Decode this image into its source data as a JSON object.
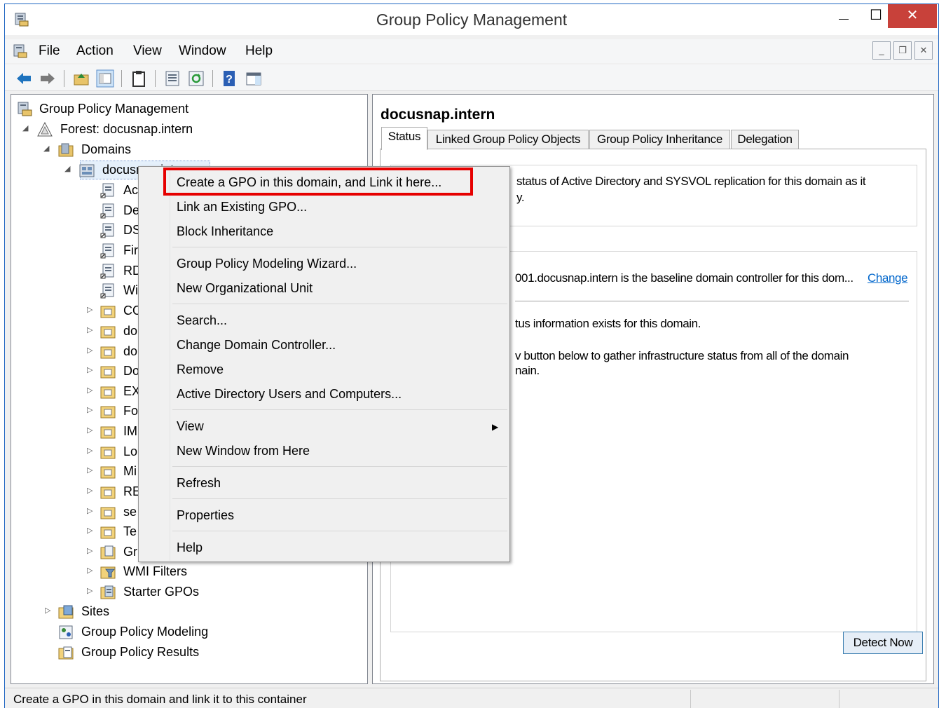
{
  "window": {
    "title": "Group Policy Management",
    "close_glyph": "✕",
    "min_glyph": "—",
    "max_glyph": "☐"
  },
  "menubar": {
    "items": [
      "File",
      "Action",
      "View",
      "Window",
      "Help"
    ]
  },
  "tree": {
    "root": "Group Policy Management",
    "forest": "Forest: docusnap.intern",
    "domains": "Domains",
    "domain": "docusnap.intern",
    "children": [
      {
        "label": "Ac",
        "type": "gpo-link"
      },
      {
        "label": "De",
        "type": "gpo-link"
      },
      {
        "label": "DS",
        "type": "gpo-link"
      },
      {
        "label": "Fir",
        "type": "gpo-link"
      },
      {
        "label": "RD",
        "type": "gpo-link"
      },
      {
        "label": "Wi",
        "type": "gpo-link"
      },
      {
        "label": "CO",
        "type": "ou"
      },
      {
        "label": "do",
        "type": "ou"
      },
      {
        "label": "do",
        "type": "ou"
      },
      {
        "label": "Do",
        "type": "ou"
      },
      {
        "label": "EX",
        "type": "ou"
      },
      {
        "label": "Fo",
        "type": "ou"
      },
      {
        "label": "IM",
        "type": "ou"
      },
      {
        "label": "Lo",
        "type": "ou"
      },
      {
        "label": "Mi",
        "type": "ou"
      },
      {
        "label": "RE",
        "type": "ou"
      },
      {
        "label": "se",
        "type": "ou"
      },
      {
        "label": "Te",
        "type": "ou"
      },
      {
        "label": "Gr",
        "type": "gpo-folder"
      },
      {
        "label": "WMI Filters",
        "type": "wmi"
      },
      {
        "label": "Starter GPOs",
        "type": "starter"
      }
    ],
    "sites": "Sites",
    "modeling": "Group Policy Modeling",
    "results": "Group Policy Results"
  },
  "right": {
    "title": "docusnap.intern",
    "tabs": [
      "Status",
      "Linked Group Policy Objects",
      "Group Policy Inheritance",
      "Delegation"
    ],
    "active_tab": "Status",
    "text1a": "status of Active Directory and SYSVOL replication for this domain as it",
    "text1b": "y.",
    "text2": "001.docusnap.intern is the baseline domain controller for this dom...",
    "change_link": "Change",
    "text3": "tus information exists for this domain.",
    "text4a": "v button below to gather infrastructure status from all of the domain",
    "text4b": "nain.",
    "detect_button": "Detect Now"
  },
  "context_menu": {
    "items": [
      "Create a GPO in this domain, and Link it here...",
      "Link an Existing GPO...",
      "Block Inheritance",
      "Group Policy Modeling Wizard...",
      "New Organizational Unit",
      "Search...",
      "Change Domain Controller...",
      "Remove",
      "Active Directory Users and Computers...",
      "View",
      "New Window from Here",
      "Refresh",
      "Properties",
      "Help"
    ],
    "submenu_arrow": "▶"
  },
  "statusbar": {
    "text": "Create a GPO in this domain and link it to this container"
  },
  "colors": {
    "highlight_border": "#e60000",
    "close_button": "#c8413a",
    "link": "#0066cc",
    "nav_arrows": "#1e73be"
  }
}
